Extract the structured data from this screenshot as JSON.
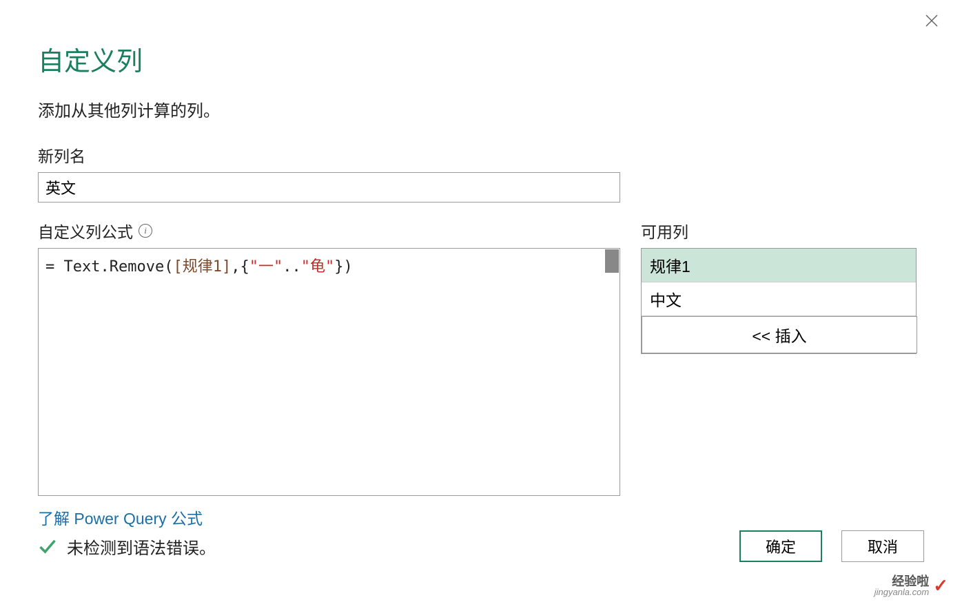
{
  "dialog": {
    "title": "自定义列",
    "subtitle": "添加从其他列计算的列。"
  },
  "new_column": {
    "label": "新列名",
    "value": "英文"
  },
  "formula": {
    "label": "自定义列公式",
    "info_icon_name": "info-icon",
    "prefix": "= ",
    "func": "Text.Remove",
    "open_paren": "(",
    "col_ref": "[规律1]",
    "comma": ",",
    "open_brace": "{",
    "str1": "\"一\"",
    "range_op": "..",
    "str2": "\"龟\"",
    "close_brace": "}",
    "close_paren": ")"
  },
  "available": {
    "label": "可用列",
    "items": [
      {
        "label": "规律1",
        "selected": true
      },
      {
        "label": "中文",
        "selected": false
      }
    ],
    "insert_label": "<< 插入"
  },
  "learn_link": "了解 Power Query 公式",
  "status": {
    "text": "未检测到语法错误。"
  },
  "buttons": {
    "ok": "确定",
    "cancel": "取消"
  },
  "watermark": {
    "top": "经验啦",
    "bot": "jingyanla.com"
  }
}
